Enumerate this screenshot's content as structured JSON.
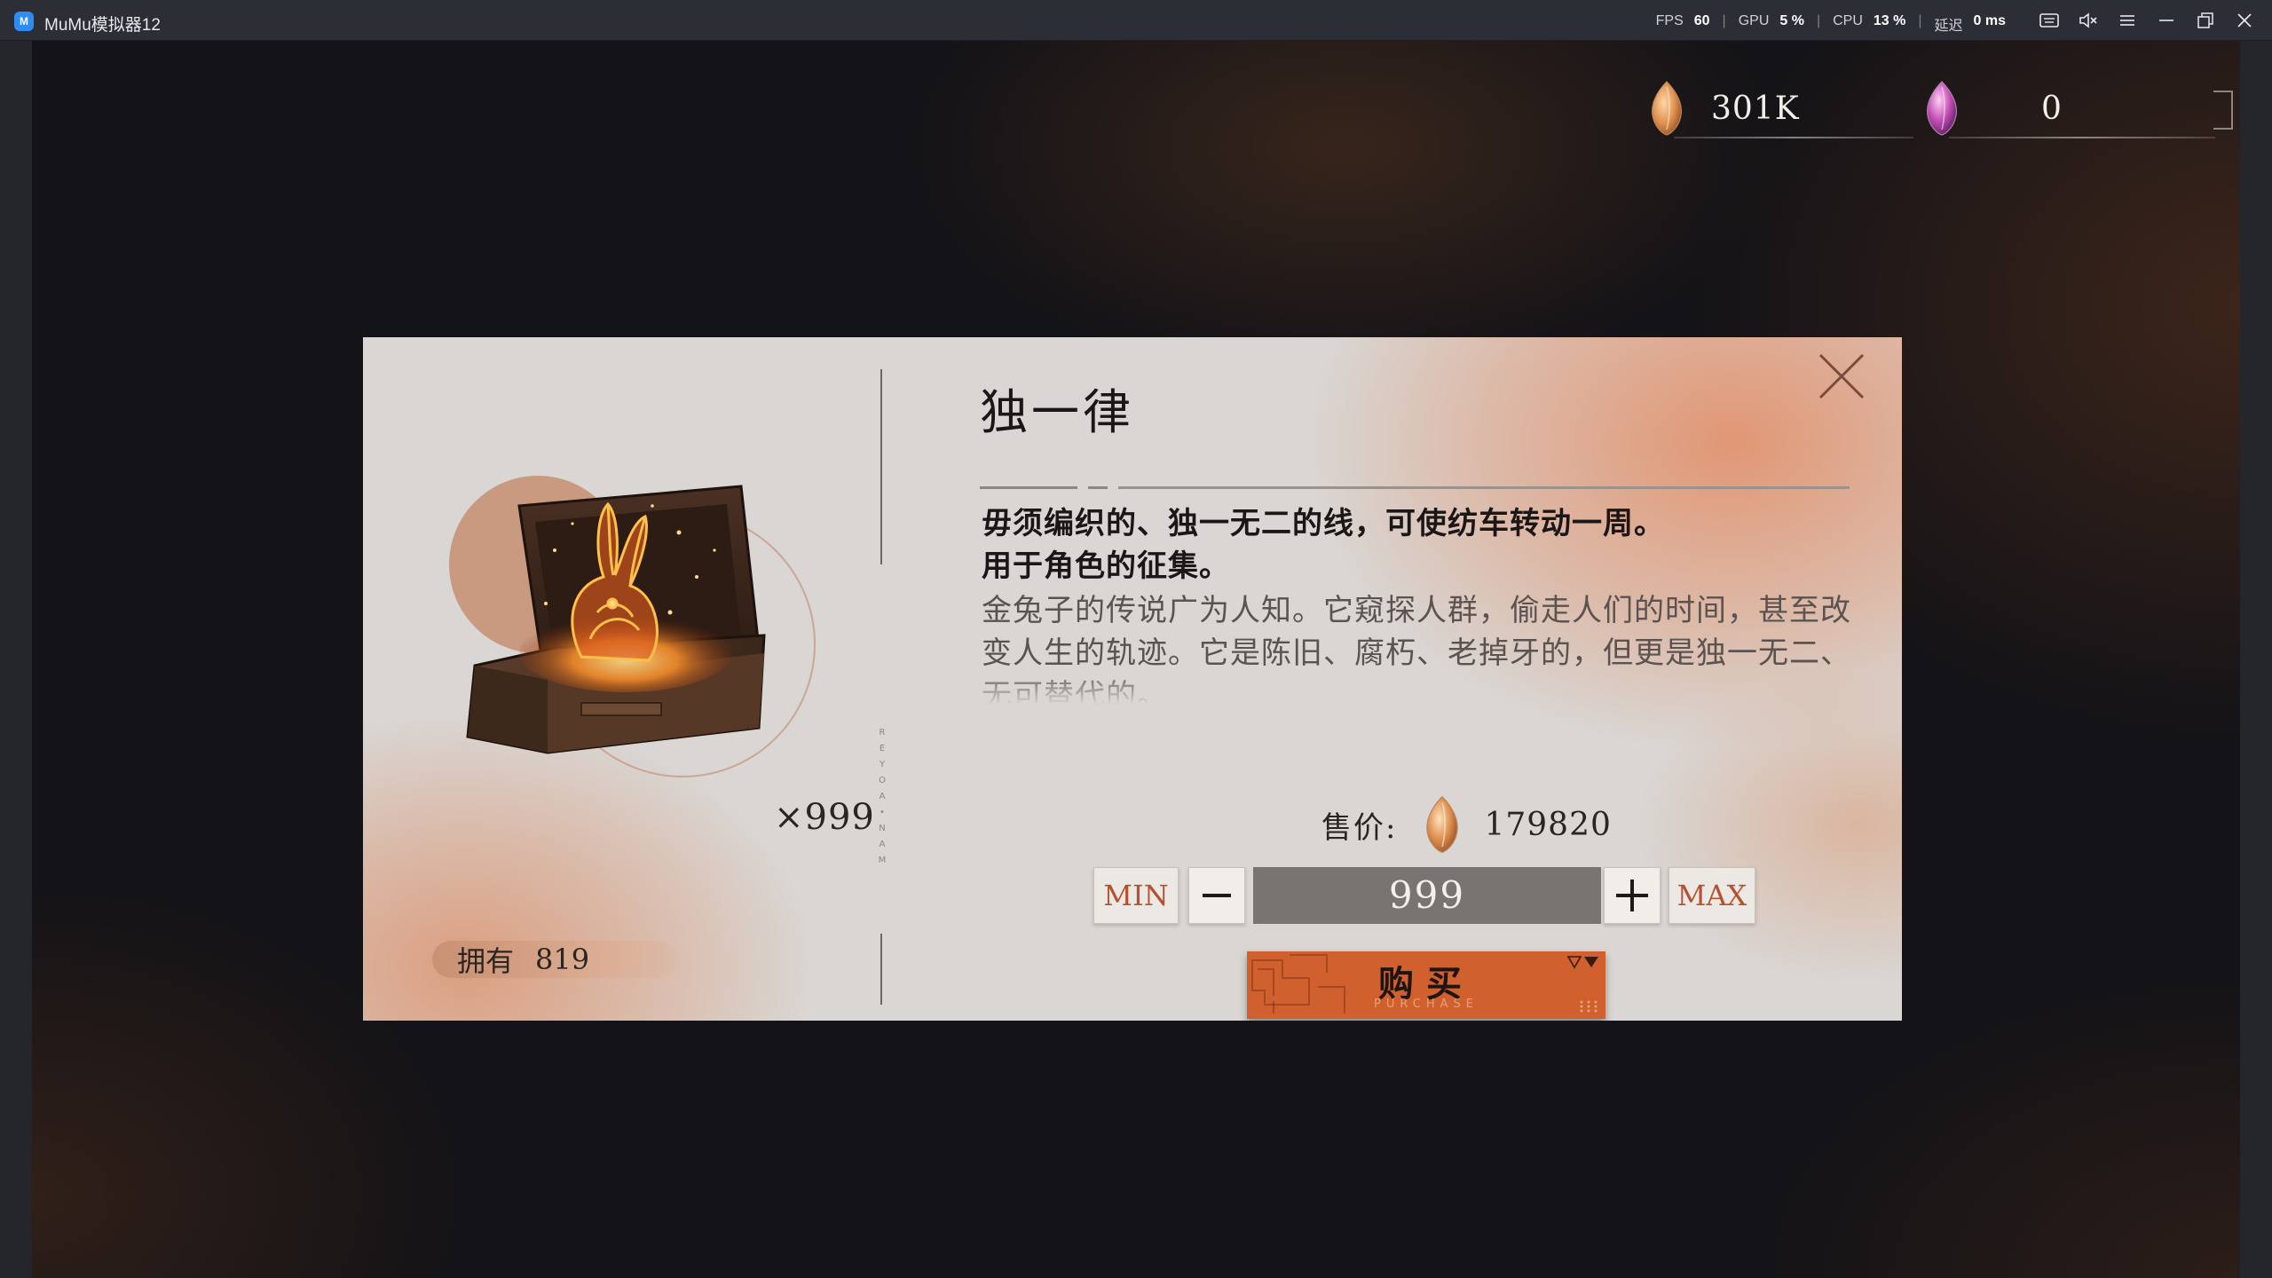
{
  "emulator": {
    "title": "MuMu模拟器12",
    "fps_label": "FPS",
    "fps_value": "60",
    "gpu_label": "GPU",
    "gpu_value": "5 %",
    "cpu_label": "CPU",
    "cpu_value": "13 %",
    "latency_label": "延迟",
    "latency_value": "0 ms"
  },
  "currency": {
    "gold": "301K",
    "gem": "0"
  },
  "item": {
    "name": "独一律",
    "quantity_badge": "×999",
    "owned_label": "拥有",
    "owned_count": "819",
    "description_line1": "毋须编织的、独一无二的线，可使纺车转动一周。",
    "description_line2": "用于角色的征集。",
    "lore": "金兔子的传说广为人知。它窥探人群，偷走人们的时间，甚至改变人生的轨迹。它是陈旧、腐朽、老掉牙的，但更是独一无二、无可替代的。",
    "vertical_letters": [
      "R",
      "E",
      "Y",
      "O",
      "A",
      "•",
      "N",
      "A",
      "M"
    ]
  },
  "purchase": {
    "price_label": "售价:",
    "price_value": "179820",
    "min_label": "MIN",
    "max_label": "MAX",
    "quantity": "999",
    "buy_label": "购买",
    "buy_sub_label": "PURCHASE"
  },
  "colors": {
    "accent": "#d0602d",
    "min_max_text": "#b35130",
    "dialog_bg": "#d9d6d3",
    "title_bar": "#2b2e35"
  },
  "icons": {
    "gold_currency": "amber-drop-gem-icon",
    "gem_currency": "purple-drop-gem-icon",
    "close": "close-x-icon",
    "minus": "minus-icon",
    "plus": "plus-icon"
  }
}
